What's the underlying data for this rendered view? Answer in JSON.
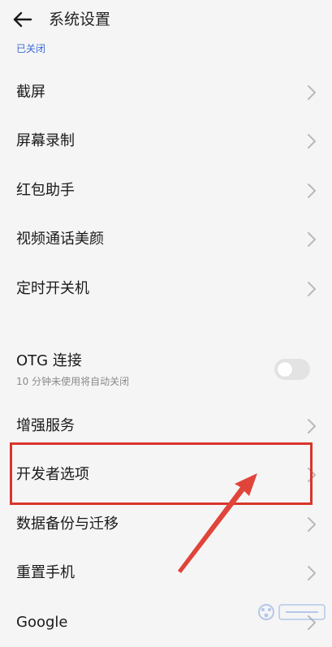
{
  "header": {
    "back_icon": "arrow-left-icon",
    "title": "系统设置"
  },
  "status_line": "已关闭",
  "items": [
    {
      "label": "截屏",
      "icon": "chevron-right-icon"
    },
    {
      "label": "屏幕录制",
      "icon": "chevron-right-icon"
    },
    {
      "label": "红包助手",
      "icon": "chevron-right-icon"
    },
    {
      "label": "视频通话美颜",
      "icon": "chevron-right-icon"
    },
    {
      "label": "定时开关机",
      "icon": "chevron-right-icon"
    },
    {
      "label": "OTG 连接",
      "sublabel": "10 分钟未使用将自动关闭",
      "toggle": "off"
    },
    {
      "label": "增强服务",
      "icon": "chevron-right-icon"
    },
    {
      "label": "开发者选项",
      "icon": "chevron-right-icon",
      "highlighted": true
    },
    {
      "label": "数据备份与迁移",
      "icon": "chevron-right-icon"
    },
    {
      "label": "重置手机",
      "icon": "chevron-right-icon"
    },
    {
      "label": "Google",
      "icon": "chevron-right-icon"
    }
  ],
  "annotation": {
    "highlight_color": "#d9352c",
    "arrow_color": "#e0443a"
  },
  "watermark": {
    "icon": "baidu-jingyan-watermark"
  }
}
